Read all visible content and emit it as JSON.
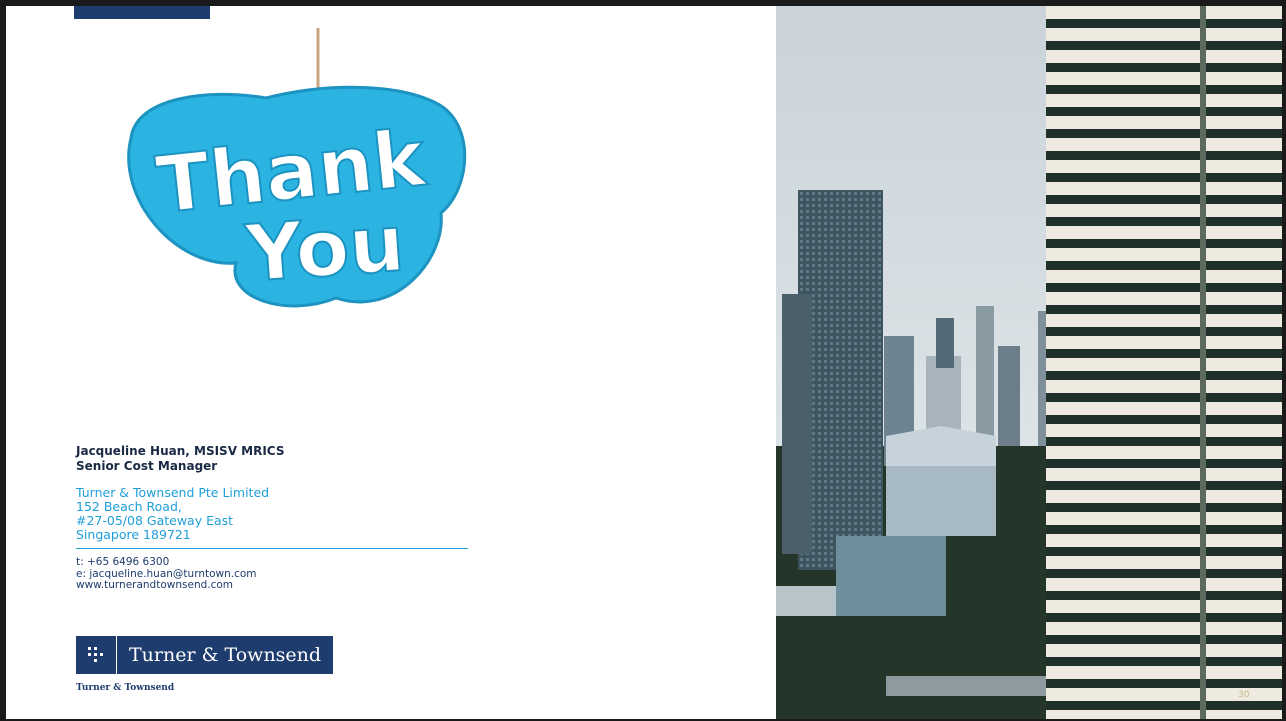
{
  "contact": {
    "name": "Jacqueline Huan, MSISV MRICS",
    "title": "Senior Cost Manager",
    "company": "Turner & Townsend Pte Limited",
    "address_lines": [
      "152 Beach Road,",
      "#27-05/08 Gateway East",
      "Singapore 189721"
    ],
    "phone": "t: +65 6496 6300",
    "email": "e: jacqueline.huan@turntown.com",
    "website": "www.turnerandtownsend.com"
  },
  "thankyou": {
    "line1": "Thank",
    "line2": "You"
  },
  "logo": {
    "text": "Turner & Townsend"
  },
  "footer": {
    "brand": "Turner & Townsend"
  },
  "page_number": "30",
  "colors": {
    "navy": "#1f3c6e",
    "accent": "#1e9fd8",
    "tag_blue": "#2bb3e2"
  }
}
